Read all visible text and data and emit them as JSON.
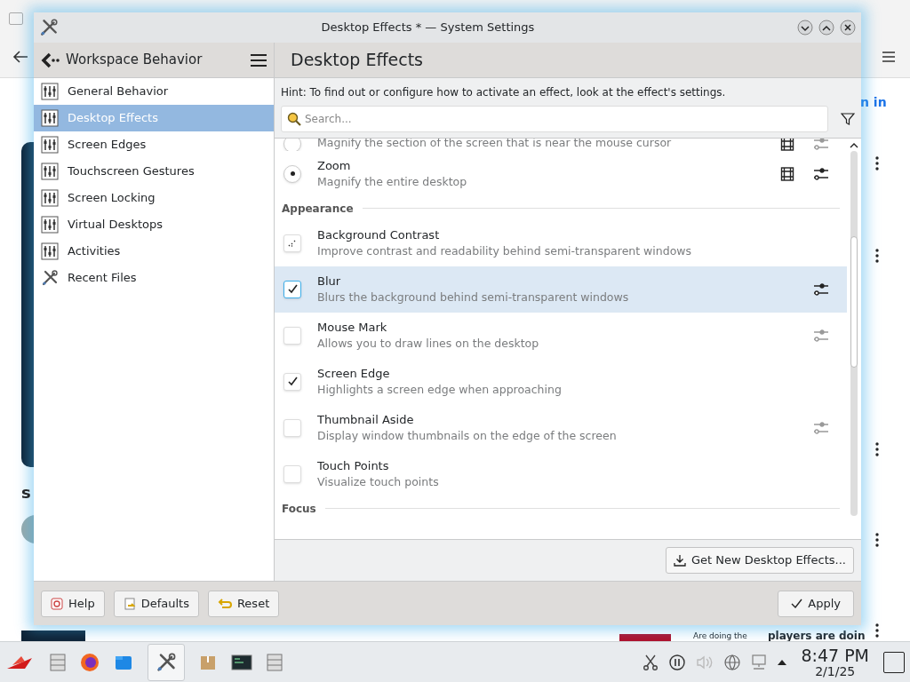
{
  "background": {
    "texts": [
      "n in",
      "s",
      "Are doing the",
      "players are doin"
    ]
  },
  "window": {
    "title": "Desktop Effects * — System Settings"
  },
  "sidebar": {
    "title": "Workspace Behavior",
    "items": [
      {
        "label": "General Behavior",
        "selected": false,
        "kind": "module"
      },
      {
        "label": "Desktop Effects",
        "selected": true,
        "kind": "module"
      },
      {
        "label": "Screen Edges",
        "selected": false,
        "kind": "module"
      },
      {
        "label": "Touchscreen Gestures",
        "selected": false,
        "kind": "module"
      },
      {
        "label": "Screen Locking",
        "selected": false,
        "kind": "module"
      },
      {
        "label": "Virtual Desktops",
        "selected": false,
        "kind": "module"
      },
      {
        "label": "Activities",
        "selected": false,
        "kind": "module"
      },
      {
        "label": "Recent Files",
        "selected": false,
        "kind": "tools"
      }
    ]
  },
  "page": {
    "title": "Desktop Effects",
    "hint": "Hint: To find out or configure how to activate an effect, look at the effect's settings.",
    "search": {
      "placeholder": "Search..."
    },
    "effects": [
      {
        "kind": "radio",
        "description": "Magnify the section of the screen that is near the mouse cursor",
        "checked": false,
        "selected": false,
        "video": true,
        "configure": true
      },
      {
        "kind": "radio",
        "name": "Zoom",
        "description": "Magnify the entire desktop",
        "checked": true,
        "selected": false,
        "video": true,
        "configure": true
      },
      {
        "kind": "section",
        "title": "Appearance"
      },
      {
        "kind": "partial",
        "name": "Background Contrast",
        "description": "Improve contrast and readability behind semi-transparent windows",
        "checked": true,
        "selected": false,
        "video": false,
        "configure": false
      },
      {
        "kind": "checkbox",
        "name": "Blur",
        "description": "Blurs the background behind semi-transparent windows",
        "checked": true,
        "selected": true,
        "video": false,
        "configure": true
      },
      {
        "kind": "checkbox",
        "name": "Mouse Mark",
        "description": "Allows you to draw lines on the desktop",
        "checked": false,
        "selected": false,
        "video": false,
        "configure": true
      },
      {
        "kind": "checkbox",
        "name": "Screen Edge",
        "description": "Highlights a screen edge when approaching",
        "checked": true,
        "selected": false,
        "video": false,
        "configure": false
      },
      {
        "kind": "checkbox",
        "name": "Thumbnail Aside",
        "description": "Display window thumbnails on the edge of the screen",
        "checked": false,
        "selected": false,
        "video": false,
        "configure": true
      },
      {
        "kind": "checkbox",
        "name": "Touch Points",
        "description": "Visualize touch points",
        "checked": false,
        "selected": false,
        "video": false,
        "configure": false
      },
      {
        "kind": "section",
        "title": "Focus"
      }
    ],
    "get_new": "Get New Desktop Effects..."
  },
  "footer": {
    "buttons": [
      {
        "label": "Help",
        "kind": "help"
      },
      {
        "label": "Defaults",
        "kind": "defaults"
      },
      {
        "label": "Reset",
        "kind": "reset"
      }
    ],
    "apply": "Apply"
  },
  "taskbar": {
    "time": "8:47 PM",
    "date": "2/1/25"
  }
}
